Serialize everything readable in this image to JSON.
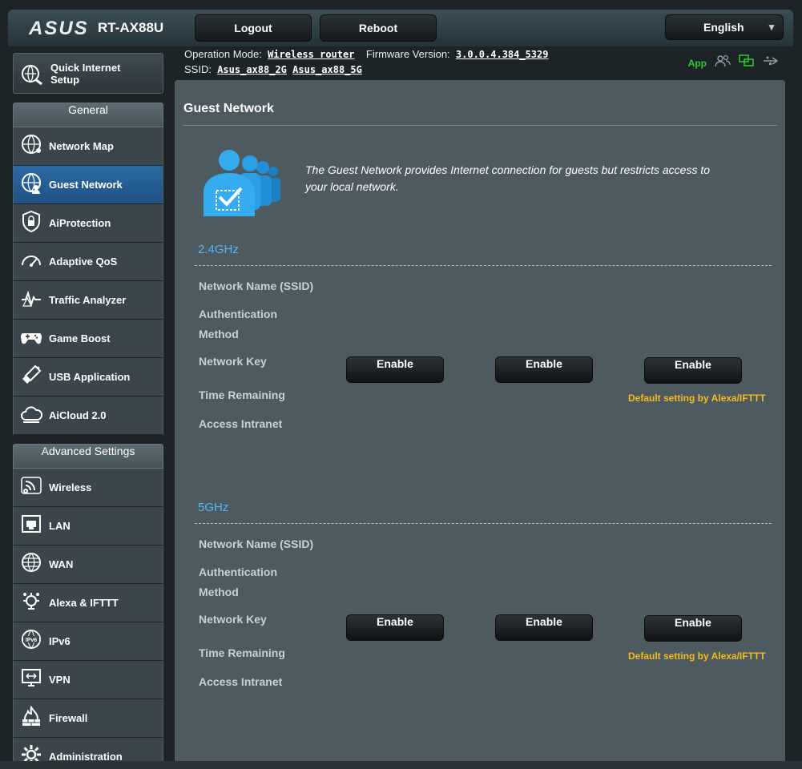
{
  "header": {
    "logo": "ASUS",
    "model": "RT-AX88U",
    "logout_label": "Logout",
    "reboot_label": "Reboot",
    "language": "English"
  },
  "info": {
    "operation_mode_label": "Operation Mode:",
    "operation_mode_value": "Wireless router",
    "firmware_label": "Firmware Version:",
    "firmware_value": "3.0.0.4.384_5329",
    "ssid_label": "SSID:",
    "ssid_2g": "Asus_ax88_2G",
    "ssid_5g": "Asus_ax88_5G",
    "app_label": "App"
  },
  "sidebar": {
    "quick_setup_line1": "Quick Internet",
    "quick_setup_line2": "Setup",
    "general_title": "General",
    "general_items": [
      {
        "label": "Network Map",
        "icon": "globe-network-icon"
      },
      {
        "label": "Guest Network",
        "icon": "guest-globe-icon"
      },
      {
        "label": "AiProtection",
        "icon": "shield-lock-icon"
      },
      {
        "label": "Adaptive QoS",
        "icon": "gauge-icon"
      },
      {
        "label": "Traffic Analyzer",
        "icon": "pulse-chart-icon"
      },
      {
        "label": "Game Boost",
        "icon": "gamepad-icon"
      },
      {
        "label": "USB Application",
        "icon": "usb-stick-icon"
      },
      {
        "label": "AiCloud 2.0",
        "icon": "cloud-icon"
      }
    ],
    "advanced_title": "Advanced Settings",
    "advanced_items": [
      {
        "label": "Wireless",
        "icon": "wifi-icon"
      },
      {
        "label": "LAN",
        "icon": "lan-port-icon"
      },
      {
        "label": "WAN",
        "icon": "globe-icon"
      },
      {
        "label": "Alexa & IFTTT",
        "icon": "alexa-icon"
      },
      {
        "label": "IPv6",
        "icon": "ipv6-globe-icon"
      },
      {
        "label": "VPN",
        "icon": "vpn-monitor-icon"
      },
      {
        "label": "Firewall",
        "icon": "firewall-icon"
      },
      {
        "label": "Administration",
        "icon": "gear-icon"
      }
    ]
  },
  "main": {
    "title": "Guest Network",
    "intro": "The Guest Network provides Internet connection for guests but restricts access to your local network.",
    "bands": [
      {
        "title": "2.4GHz"
      },
      {
        "title": "5GHz"
      }
    ],
    "fields": [
      "Network Name (SSID)",
      "Authentication",
      "Method",
      "Network Key",
      "Time Remaining",
      "Access Intranet"
    ],
    "enable_label": "Enable",
    "alexa_note": "Default setting by Alexa/IFTTT"
  },
  "colors": {
    "accent_blue": "#5ab3f0",
    "alexa_yellow": "#f5bb1f",
    "app_green": "#2ecc2e",
    "active_nav": "#2a6aa3"
  }
}
